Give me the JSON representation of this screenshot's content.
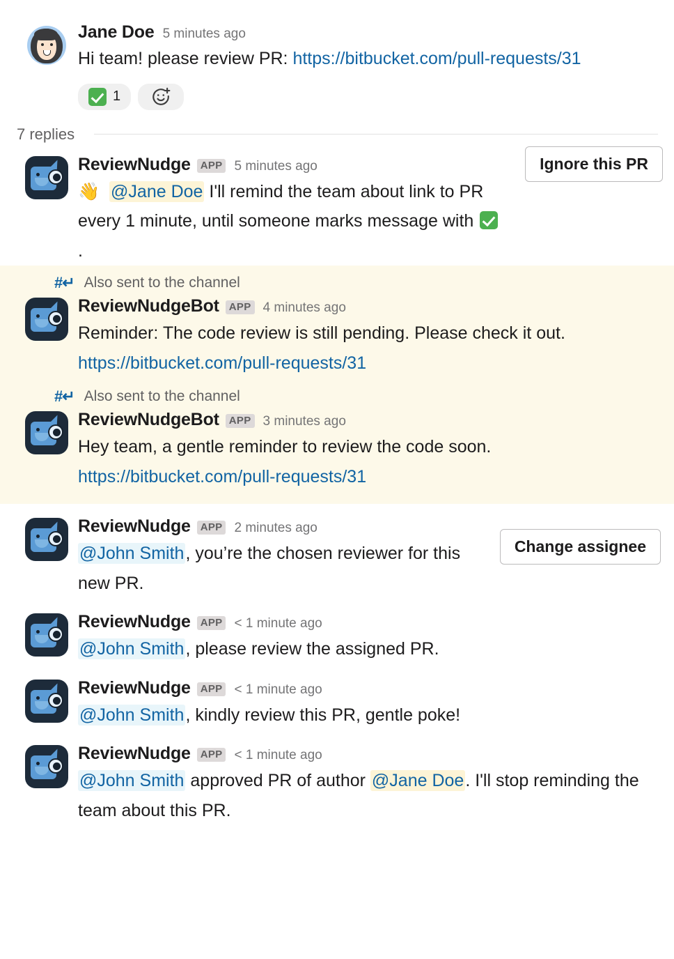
{
  "root_message": {
    "avatar": "woman-avatar",
    "author": "Jane Doe",
    "timestamp": "5 minutes ago",
    "text_before_link": "Hi team! please review PR: ",
    "link": "https://bitbucket.com/pull-requests/31",
    "reactions": [
      {
        "emoji": "white-check-mark",
        "count": "1"
      }
    ],
    "add_reaction_icon": "add-reaction-icon"
  },
  "thread": {
    "replies_label": "7 replies"
  },
  "broadcast_notice": {
    "icon": "channel-broadcast-icon",
    "label": "Also sent to the channel"
  },
  "replies": [
    {
      "avatar": "bot-avatar",
      "author": "ReviewNudge",
      "app_badge": "APP",
      "timestamp": "5 minutes ago",
      "emoji": "wave",
      "mention": "@Jane Doe",
      "mention_style": "yellow",
      "text_after": " I'll remind the team about link to PR every 1 minute, until someone marks message with ",
      "text_tail": ".",
      "action_button": "Ignore this PR"
    },
    {
      "avatar": "bot-avatar",
      "author": "ReviewNudgeBot",
      "app_badge": "APP",
      "timestamp": "4 minutes ago",
      "text": "Reminder: The code review is still pending. Please check it out. ",
      "link": "https://bitbucket.com/pull-requests/31"
    },
    {
      "avatar": "bot-avatar",
      "author": "ReviewNudgeBot",
      "app_badge": "APP",
      "timestamp": "3 minutes ago",
      "text": "Hey team, a gentle reminder to review the code soon. ",
      "link": "https://bitbucket.com/pull-requests/31"
    },
    {
      "avatar": "bot-avatar",
      "author": "ReviewNudge",
      "app_badge": "APP",
      "timestamp": "2 minutes ago",
      "mention": "@John Smith",
      "mention_style": "blue",
      "text_after": ", you’re the chosen reviewer for this new PR.",
      "action_button": "Change assignee"
    },
    {
      "avatar": "bot-avatar",
      "author": "ReviewNudge",
      "app_badge": "APP",
      "timestamp": "< 1 minute ago",
      "mention": "@John Smith",
      "mention_style": "blue",
      "text_after": ", please review the assigned PR."
    },
    {
      "avatar": "bot-avatar",
      "author": "ReviewNudge",
      "app_badge": "APP",
      "timestamp": "< 1 minute ago",
      "mention": "@John Smith",
      "mention_style": "blue",
      "text_after": ", kindly review this PR, gentle poke!"
    },
    {
      "avatar": "bot-avatar",
      "author": "ReviewNudge",
      "app_badge": "APP",
      "timestamp": "< 1 minute ago",
      "mention": "@John Smith",
      "mention_style": "blue",
      "text_middle": " approved PR of author ",
      "mention2": "@Jane Doe",
      "mention2_style": "yellow",
      "text_after": ". I'll stop reminding the team about this PR."
    }
  ],
  "colors": {
    "link": "#1264a3",
    "mention_blue_bg": "#e8f5fa",
    "mention_yellow_bg": "#fdf4d6",
    "broadcast_bg": "#fdf9e9",
    "app_badge_bg": "#ddd9d9",
    "reaction_bg": "#f0f0f0",
    "check_green": "#4cb050"
  }
}
